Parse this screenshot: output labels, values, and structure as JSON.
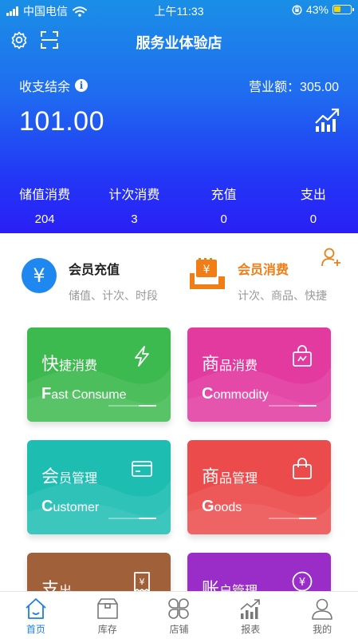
{
  "status_bar": {
    "carrier": "中国电信",
    "time": "上午11:33",
    "battery": "43%",
    "battery_level": 0.43
  },
  "header": {
    "title": "服务业体验店",
    "settings_icon": "gear-icon",
    "scan_icon": "scan-icon"
  },
  "summary": {
    "balance_label": "收支结余",
    "balance_value": "101.00",
    "revenue_label": "营业额：305.00"
  },
  "stats": [
    {
      "label": "储值消费",
      "value": "204"
    },
    {
      "label": "计次消费",
      "value": "3"
    },
    {
      "label": "充值",
      "value": "0"
    },
    {
      "label": "支出",
      "value": "0"
    }
  ],
  "shortcuts": {
    "recharge": {
      "title": "会员充值",
      "subtitle": "储值、计次、时段",
      "color": "#1e88f0"
    },
    "consume": {
      "title": "会员消费",
      "subtitle": "计次、商品、快捷",
      "color": "#f07d16"
    }
  },
  "cards": [
    {
      "id": "fast",
      "t_first": "快",
      "t_rest": "捷消费",
      "s_first": "F",
      "s_rest": "ast Consume",
      "color": "#3dba4f",
      "icon": "lightning-icon"
    },
    {
      "id": "commodity",
      "t_first": "商",
      "t_rest": "品消费",
      "s_first": "C",
      "s_rest": "ommodity",
      "color": "#e33aa0",
      "icon": "shopping-bag-icon"
    },
    {
      "id": "customer",
      "t_first": "会",
      "t_rest": "员管理",
      "s_first": "C",
      "s_rest": "ustomer",
      "color": "#1dbdb2",
      "icon": "member-card-icon"
    },
    {
      "id": "goods",
      "t_first": "商",
      "t_rest": "品管理",
      "s_first": "G",
      "s_rest": "oods",
      "color": "#ec4b4b",
      "icon": "bag-icon"
    },
    {
      "id": "expense",
      "t_first": "支",
      "t_rest": "出",
      "s_first": "",
      "s_rest": "",
      "color": "#a0603a",
      "icon": "receipt-icon"
    },
    {
      "id": "account",
      "t_first": "账",
      "t_rest": "户管理",
      "s_first": "",
      "s_rest": "",
      "color": "#9a2cc8",
      "icon": "yuan-coin-icon"
    }
  ],
  "tabs": [
    {
      "label": "首页",
      "icon": "home-icon",
      "active": true
    },
    {
      "label": "库存",
      "icon": "box-icon",
      "active": false
    },
    {
      "label": "店铺",
      "icon": "store-icon",
      "active": false
    },
    {
      "label": "报表",
      "icon": "chart-icon",
      "active": false
    },
    {
      "label": "我的",
      "icon": "user-icon",
      "active": false
    }
  ]
}
